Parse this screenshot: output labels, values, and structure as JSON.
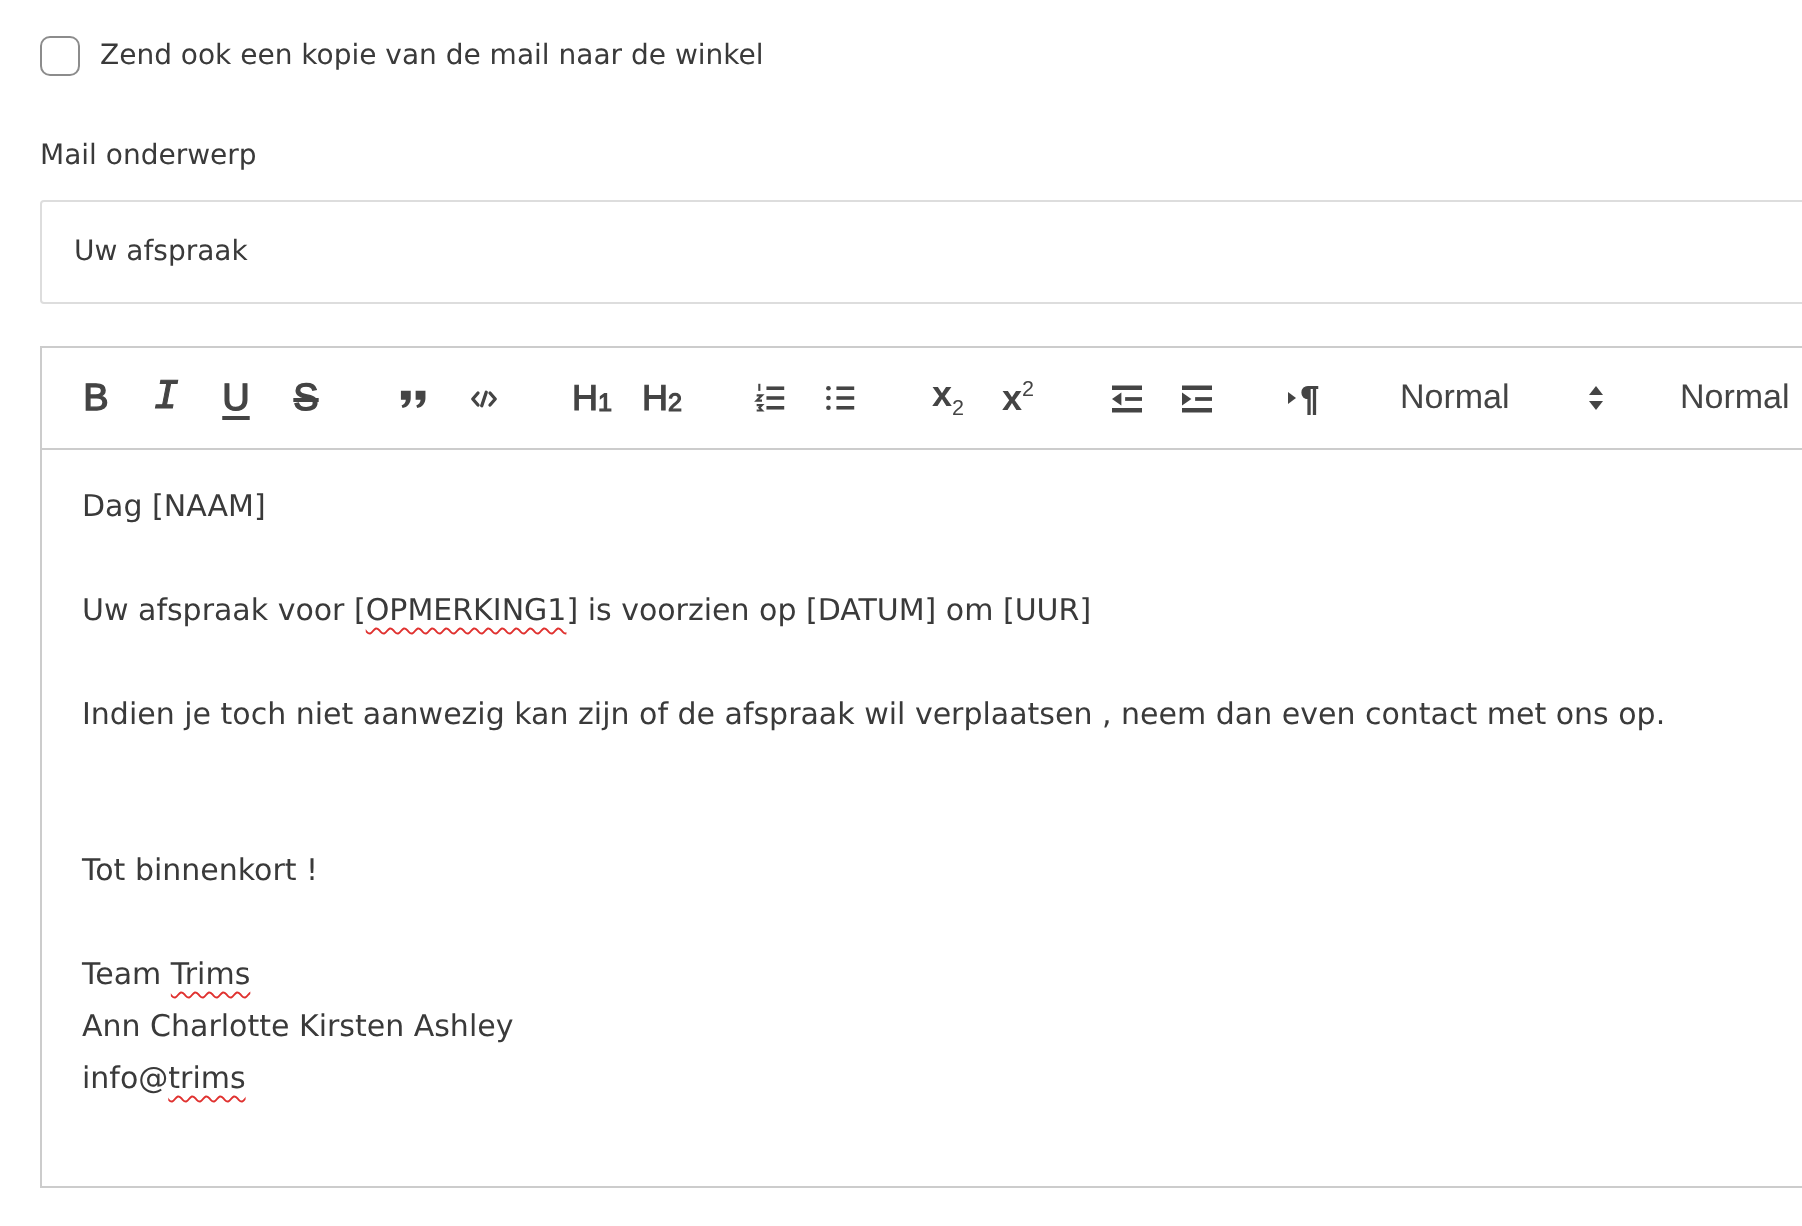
{
  "copy_to_shop": {
    "label": "Zend ook een kopie van de mail naar de winkel",
    "checked": false
  },
  "subject": {
    "label": "Mail onderwerp",
    "value": "Uw afspraak"
  },
  "editor": {
    "toolbar": {
      "groups": [
        {
          "buttons": [
            {
              "kind": "bold",
              "label": "B"
            },
            {
              "kind": "italic",
              "label": "I"
            },
            {
              "kind": "underline",
              "label": "U"
            },
            {
              "kind": "strike",
              "label": "S"
            }
          ]
        },
        {
          "buttons": [
            {
              "kind": "quote"
            },
            {
              "kind": "code"
            }
          ]
        },
        {
          "buttons": [
            {
              "kind": "heading",
              "label": "H$_{1}$"
            },
            {
              "kind": "heading",
              "label": "H$_{2}$"
            }
          ]
        },
        {
          "buttons": [
            {
              "kind": "ordered-list"
            },
            {
              "kind": "bullet-list"
            }
          ]
        },
        {
          "buttons": [
            {
              "kind": "subscript",
              "label": "x$_{2}$"
            },
            {
              "kind": "superscript",
              "label": "x$^{2}$"
            }
          ]
        },
        {
          "buttons": [
            {
              "kind": "outdent"
            },
            {
              "kind": "indent"
            }
          ]
        },
        {
          "buttons": [
            {
              "kind": "direction",
              "label": "¶"
            }
          ]
        }
      ],
      "pickers": [
        {
          "value": "Normal",
          "arrows": true
        },
        {
          "value": "Normal"
        }
      ]
    },
    "lines": [
      {
        "kind": "text",
        "segments": [
          {
            "text": "Dag [NAAM]",
            "misspelled": false
          }
        ]
      },
      {
        "kind": "blank"
      },
      {
        "kind": "text",
        "segments": [
          {
            "text": "Uw afspraak voor [",
            "misspelled": false
          },
          {
            "text": "OPMERKING1",
            "misspelled": true
          },
          {
            "text": "] is voorzien op [DATUM] om [UUR]",
            "misspelled": false
          }
        ]
      },
      {
        "kind": "blank"
      },
      {
        "kind": "text",
        "segments": [
          {
            "text": "Indien je toch niet aanwezig kan zijn of de afspraak wil verplaatsen , neem dan even contact met ons op.",
            "misspelled": false
          }
        ]
      },
      {
        "kind": "blank"
      },
      {
        "kind": "blank"
      },
      {
        "kind": "text",
        "segments": [
          {
            "text": "Tot binnenkort !",
            "misspelled": false
          }
        ]
      },
      {
        "kind": "blank"
      },
      {
        "kind": "text",
        "segments": [
          {
            "text": "Team ",
            "misspelled": false
          },
          {
            "text": "Trims",
            "misspelled": true
          }
        ]
      },
      {
        "kind": "text",
        "segments": [
          {
            "text": "Ann Charlotte Kirsten Ashley",
            "misspelled": false
          }
        ]
      },
      {
        "kind": "text",
        "segments": [
          {
            "text": "info@",
            "misspelled": false
          },
          {
            "text": "trims",
            "misspelled": true
          }
        ]
      }
    ]
  }
}
